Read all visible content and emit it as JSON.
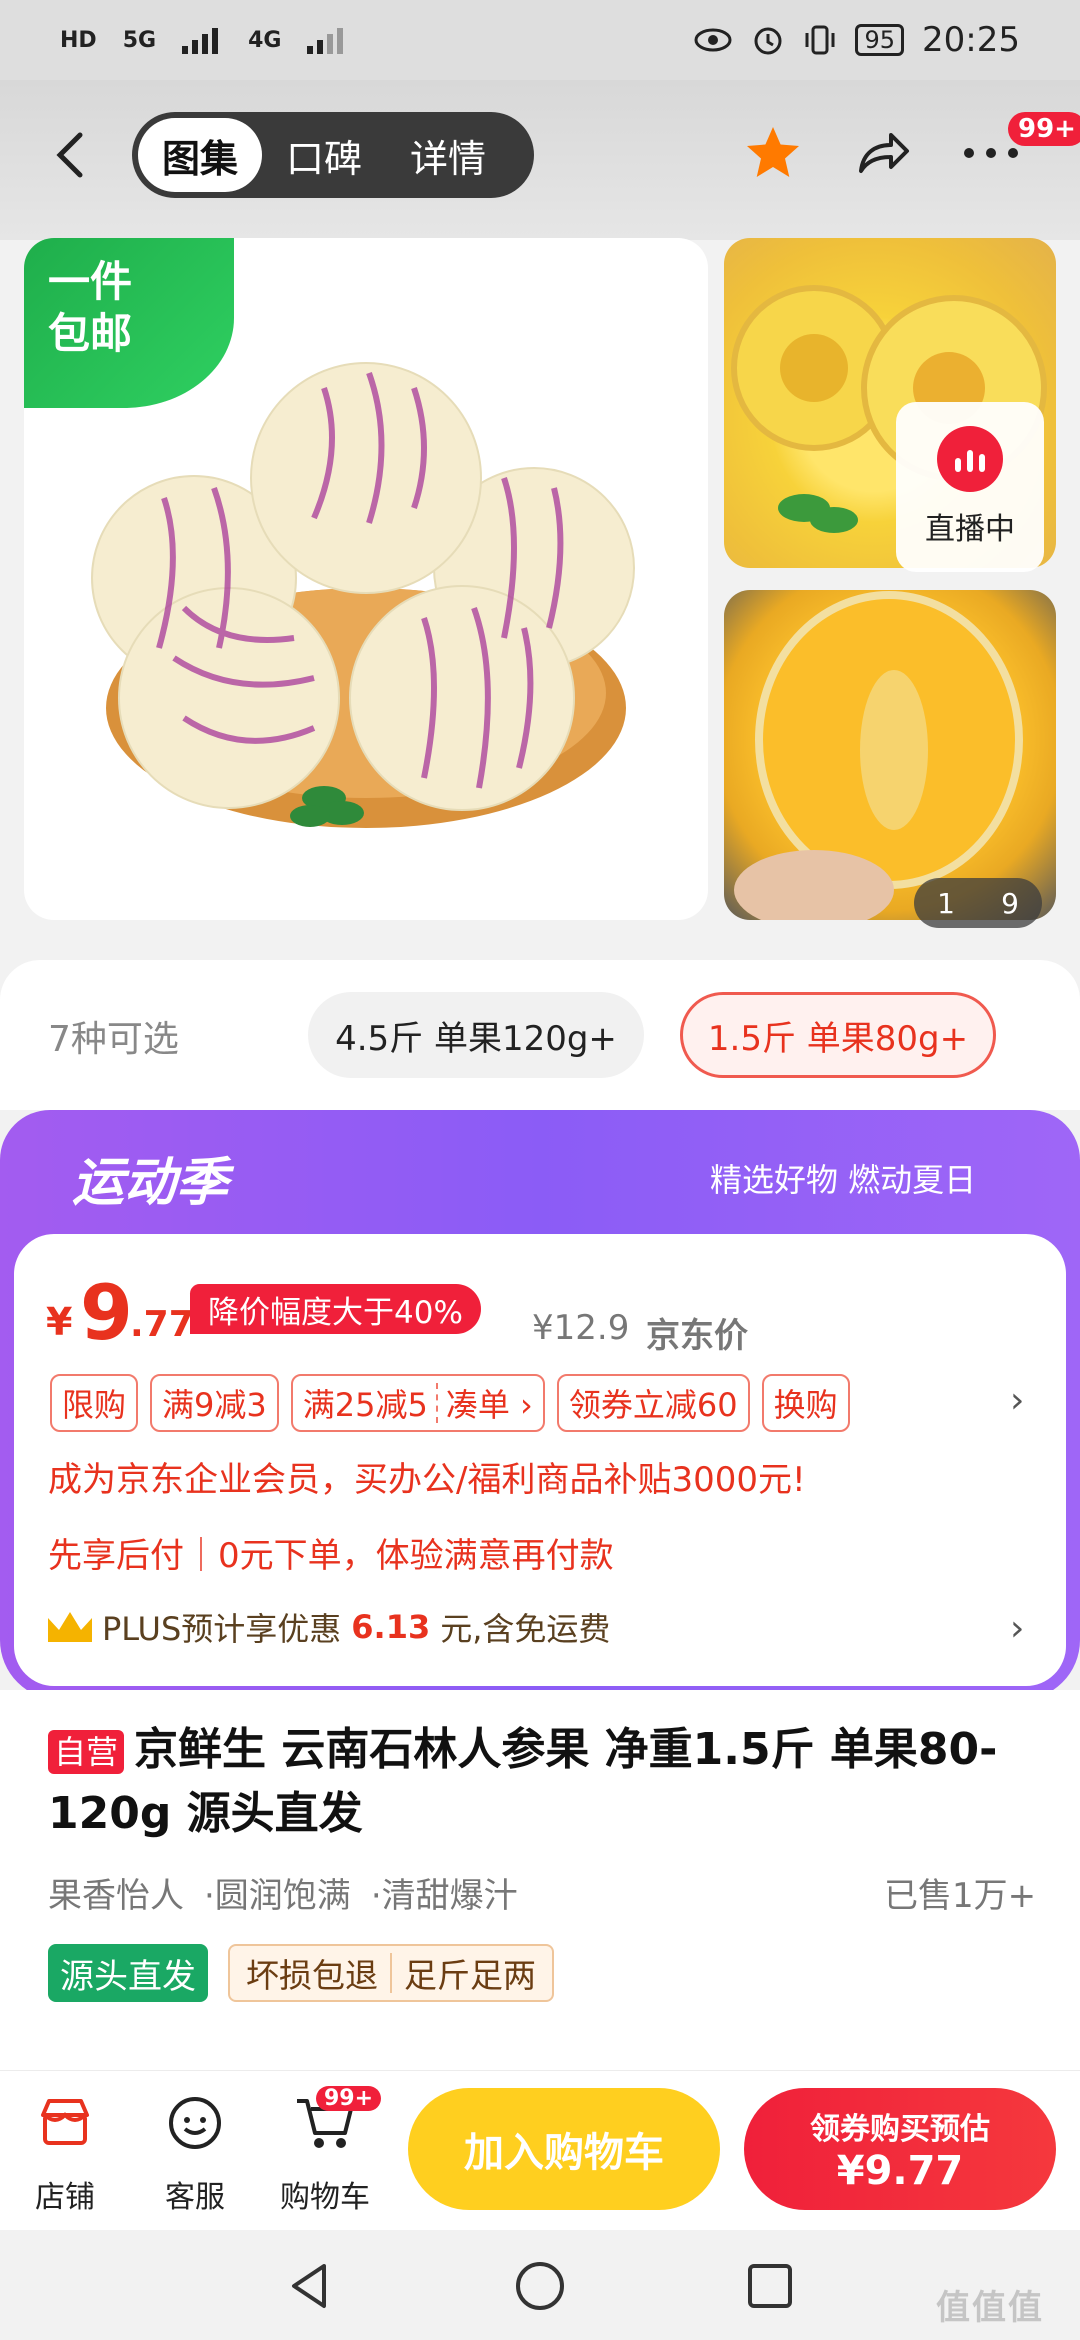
{
  "status_bar": {
    "signal_labels": [
      "HD",
      "HD",
      "5G",
      "4G"
    ],
    "battery": "95",
    "time": "20:25"
  },
  "header": {
    "tabs": [
      "图集",
      "口碑",
      "详情"
    ],
    "active_tab": "图集",
    "more_badge": "99+",
    "favorite_color": "#ff7a00"
  },
  "gallery": {
    "shipping_tag_line1": "一件",
    "shipping_tag_line2": "包邮",
    "live_label": "直播中",
    "pager_current": "1",
    "pager_total": "9"
  },
  "variants": {
    "count_label": "7种可选",
    "options": [
      "4.5斤 单果120g+",
      "1.5斤 单果80g+"
    ],
    "selected": "1.5斤 单果80g+"
  },
  "promo": {
    "title": "运动季",
    "slogan": "精选好物 燃动夏日"
  },
  "price": {
    "currency": "¥",
    "integer": "9",
    "decimal": ".77",
    "drop_tag": "降价幅度大于40%",
    "original": "¥12.9",
    "original_label": "京东价"
  },
  "coupons": [
    "限购",
    "满9减3",
    "满25减5",
    "凑单 ›",
    "领券立减60",
    "换购"
  ],
  "enterprise_line": "成为京东企业会员，买办公/福利商品补贴3000元!",
  "paylater_line": "先享后付｜0元下单，体验满意再付款",
  "plus": {
    "prefix": "PLUS预计享优惠",
    "amount": "6.13",
    "suffix": "元,含免运费"
  },
  "product": {
    "self_tag": "自营",
    "title": "京鲜生 云南石林人参果 净重1.5斤 单果80-120g  源头直发",
    "features": [
      "果香怡人",
      "·圆润饱满",
      "·清甜爆汁"
    ],
    "sold": "已售1万+",
    "source_badge": "源头直发",
    "guarantees": [
      "坏损包退",
      "足斤足两"
    ]
  },
  "action_bar": {
    "shop": "店铺",
    "service": "客服",
    "cart": "购物车",
    "cart_badge": "99+",
    "add_to_cart": "加入购物车",
    "buy_line1": "领券购买预估",
    "buy_line2": "¥9.77"
  },
  "watermark": "值值值"
}
